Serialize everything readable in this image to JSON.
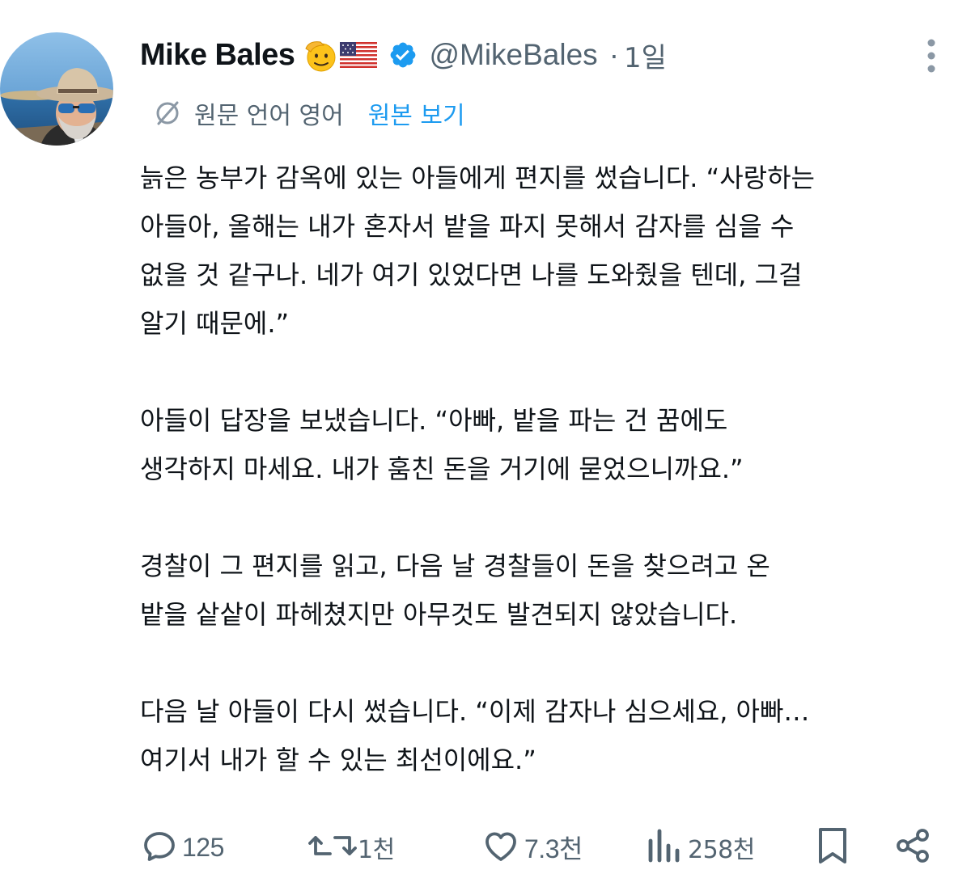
{
  "author": {
    "display_name": "Mike Bales",
    "handle": "@MikeBales",
    "separator": "·",
    "time_ago": "1일",
    "avatar_icon": "avatar-photo",
    "badges": [
      "saluting-face-emoji",
      "us-flag-emoji"
    ],
    "verified_icon": "verified-badge-icon",
    "verified_color": "#1d9bf0"
  },
  "translation": {
    "icon": "translate-icon",
    "original_language_label": "원문 언어 영어",
    "view_original_label": "원본 보기",
    "link_color": "#1d9bf0"
  },
  "tweet": {
    "paragraphs": [
      "늙은 농부가 감옥에 있는 아들에게 편지를 썼습니다. “사랑하는\n아들아, 올해는 내가 혼자서 밭을 파지 못해서 감자를 심을 수\n없을 것 같구나. 네가 여기 있었다면 나를 도와줬을 텐데, 그걸\n알기 때문에.”",
      "아들이 답장을 보냈습니다. “아빠, 밭을 파는 건 꿈에도\n생각하지 마세요. 내가 훔친 돈을 거기에 묻었으니까요.”",
      "경찰이 그 편지를 읽고, 다음 날 경찰들이 돈을 찾으려고 온\n밭을 샅샅이 파헤쳤지만 아무것도 발견되지 않았습니다.",
      "다음 날 아들이 다시 썼습니다. “이제 감자나 심으세요, 아빠…\n여기서 내가 할 수 있는 최선이에요.”"
    ]
  },
  "actions": {
    "reply": {
      "icon": "reply-icon",
      "count": "125"
    },
    "repost": {
      "icon": "repost-icon",
      "count": "1천"
    },
    "like": {
      "icon": "heart-icon",
      "count": "7.3천"
    },
    "views": {
      "icon": "views-chart-icon",
      "count": "258천"
    },
    "bookmark": {
      "icon": "bookmark-icon"
    },
    "share": {
      "icon": "share-icon"
    }
  },
  "colors": {
    "text_primary": "#0f1419",
    "text_secondary": "#536471",
    "accent": "#1d9bf0"
  }
}
